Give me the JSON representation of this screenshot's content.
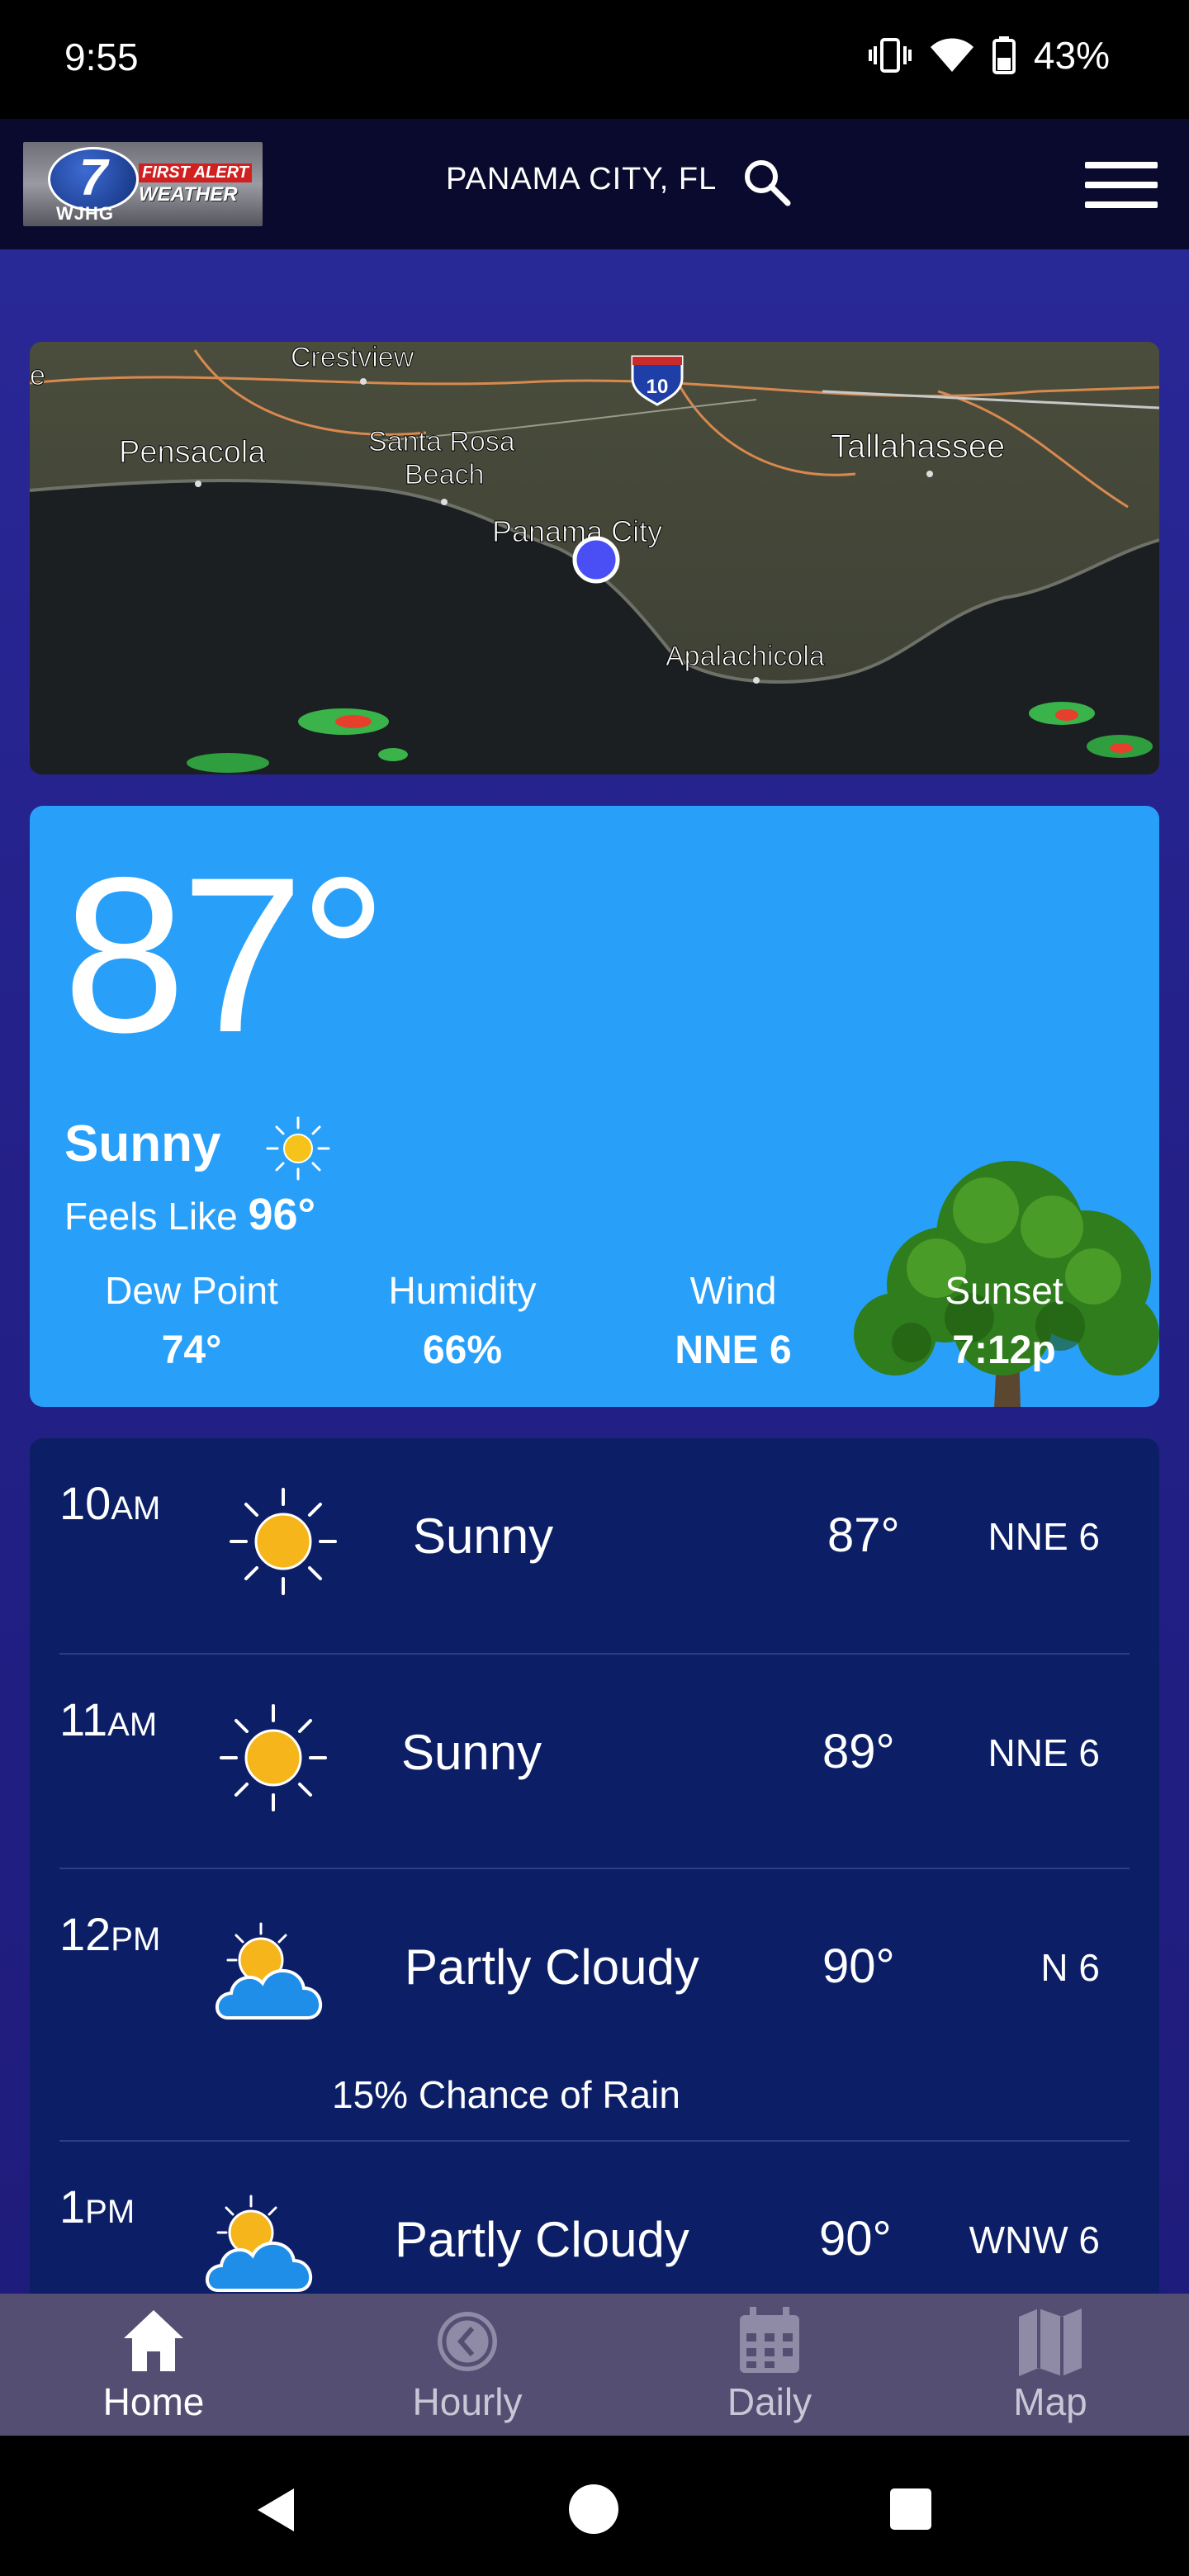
{
  "status_bar": {
    "time": "9:55",
    "battery": "43%"
  },
  "header": {
    "logo": {
      "number": "7",
      "call_sign": "WJHG",
      "line1": "FIRST ALERT",
      "line2": "WEATHER"
    },
    "location": "PANAMA CITY, FL"
  },
  "map": {
    "labels": [
      "Crestview",
      "Pensacola",
      "Santa Rosa",
      "Beach",
      "Panama City",
      "Tallahassee",
      "Apalachicola",
      "10",
      "e"
    ]
  },
  "current": {
    "temperature": "87°",
    "condition": "Sunny",
    "feels_like_label": "Feels Like",
    "feels_like_value": "96°",
    "stats": [
      {
        "label": "Dew Point",
        "value": "74°"
      },
      {
        "label": "Humidity",
        "value": "66%"
      },
      {
        "label": "Wind",
        "value": "NNE 6"
      },
      {
        "label": "Sunset",
        "value": "7:12p"
      }
    ]
  },
  "hourly": [
    {
      "hour": "10",
      "ampm": "AM",
      "icon": "sun-icon",
      "desc": "Sunny",
      "temp": "87°",
      "wind": "NNE 6"
    },
    {
      "hour": "11",
      "ampm": "AM",
      "icon": "sun-icon",
      "desc": "Sunny",
      "temp": "89°",
      "wind": "NNE 6"
    },
    {
      "hour": "12",
      "ampm": "PM",
      "icon": "partly-cloudy-icon",
      "desc": "Partly Cloudy",
      "temp": "90°",
      "wind": "N 6",
      "rain": "15% Chance of Rain"
    },
    {
      "hour": "1",
      "ampm": "PM",
      "icon": "partly-cloudy-icon",
      "desc": "Partly Cloudy",
      "temp": "90°",
      "wind": "WNW 6"
    }
  ],
  "nav": [
    {
      "label": "Home",
      "icon": "home-icon",
      "active": true
    },
    {
      "label": "Hourly",
      "icon": "clock-icon"
    },
    {
      "label": "Daily",
      "icon": "calendar-icon"
    },
    {
      "label": "Map",
      "icon": "map-icon"
    }
  ],
  "colors": {
    "accent": "#28a0fa",
    "hourly_bg": "#0c1f66",
    "nav_bg": "#544f72"
  }
}
